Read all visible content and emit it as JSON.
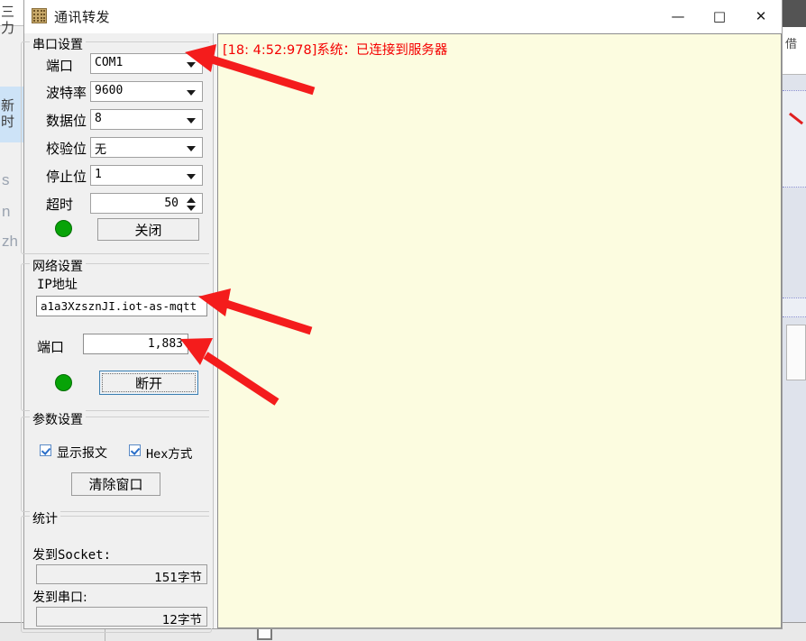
{
  "window": {
    "title": "通讯转发",
    "icon": "grid-icon",
    "controls": {
      "minimize": "—",
      "maximize": "□",
      "close": "✕"
    }
  },
  "serial_settings": {
    "group_title": "串口设置",
    "fields": [
      {
        "label": "端口",
        "value": "COM1",
        "type": "combo"
      },
      {
        "label": "波特率",
        "value": "9600",
        "type": "combo"
      },
      {
        "label": "数据位",
        "value": "8",
        "type": "combo"
      },
      {
        "label": "校验位",
        "value": "无",
        "type": "combo"
      },
      {
        "label": "停止位",
        "value": "1",
        "type": "combo"
      },
      {
        "label": "超时",
        "value": "50",
        "type": "spinner"
      }
    ],
    "status_led": "#07a307",
    "action_button": "关闭"
  },
  "network_settings": {
    "group_title": "网络设置",
    "ip_label": "IP地址",
    "ip_value": "a1a3XzsznJI.iot-as-mqtt",
    "port_label": "端口",
    "port_value": "1,883",
    "status_led": "#07a307",
    "action_button": "断开"
  },
  "parameter_settings": {
    "group_title": "参数设置",
    "checkboxes": [
      {
        "label": "显示报文",
        "checked": true
      },
      {
        "label": "Hex方式",
        "checked": true
      }
    ],
    "clear_button": "清除窗口"
  },
  "statistics": {
    "group_title": "统计",
    "items": [
      {
        "label": "发到Socket:",
        "value": "151字节"
      },
      {
        "label": "发到串口:",
        "value": "12字节"
      }
    ]
  },
  "log_panel": {
    "background": "#fcfce0",
    "text_color": "#f40000",
    "lines": [
      "[18: 4:52:978]系统：已连接到服务器"
    ]
  },
  "annotations": {
    "color": "#f41c1c",
    "arrows": [
      {
        "name": "arrow-to-port-combo"
      },
      {
        "name": "arrow-to-ip-field"
      },
      {
        "name": "arrow-to-network-port-field"
      }
    ]
  },
  "background_windows": {
    "left_glyphs": [
      "三",
      "力",
      "新",
      "时",
      "s",
      "n",
      "zh"
    ],
    "right_glyphs": [
      "借"
    ]
  }
}
